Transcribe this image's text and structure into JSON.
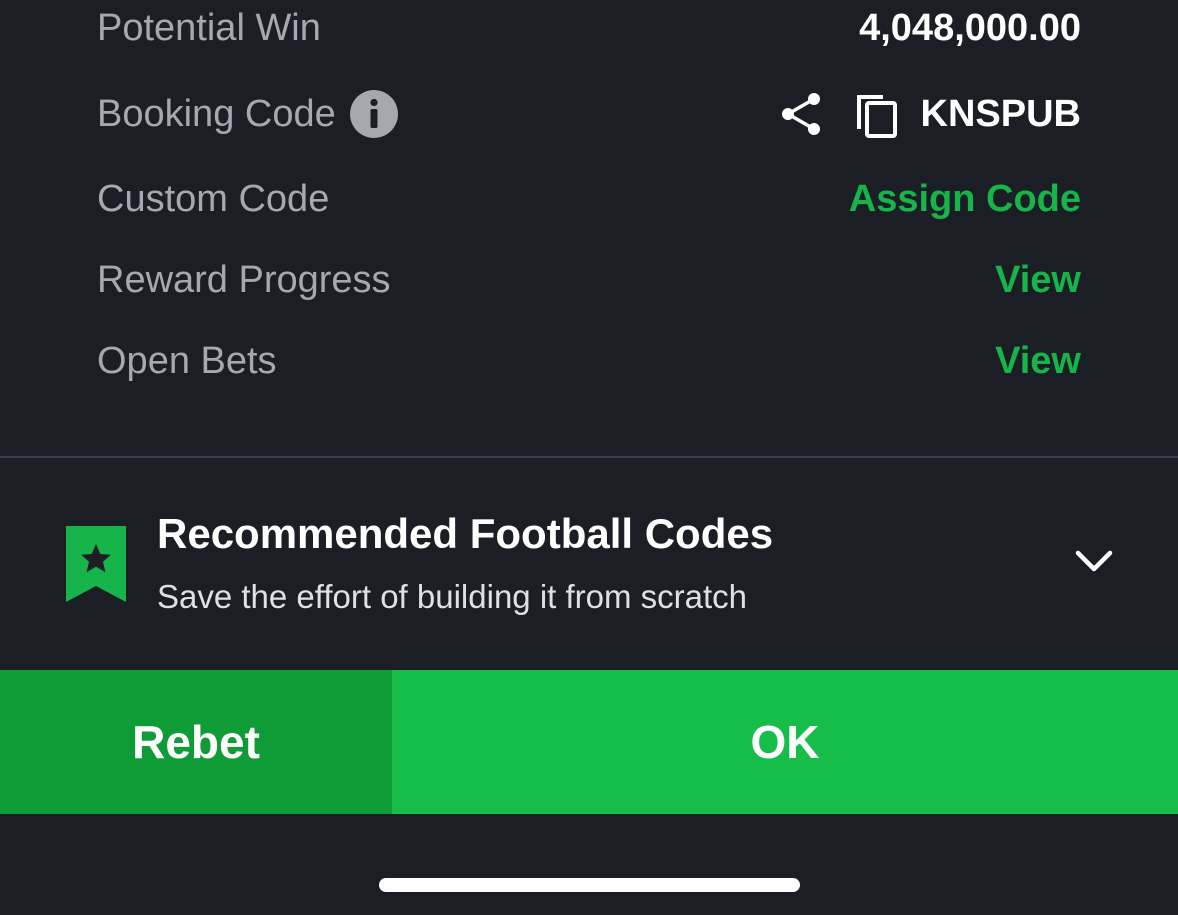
{
  "summary": {
    "potential_win": {
      "label": "Potential Win",
      "value": "4,048,000.00"
    },
    "booking_code": {
      "label": "Booking Code",
      "value": "KNSPUB"
    },
    "custom_code": {
      "label": "Custom Code",
      "action": "Assign Code"
    },
    "reward_progress": {
      "label": "Reward Progress",
      "action": "View"
    },
    "open_bets": {
      "label": "Open Bets",
      "action": "View"
    }
  },
  "recommended": {
    "title": "Recommended Football Codes",
    "subtitle": "Save the effort of building it from scratch"
  },
  "actions": {
    "rebet_label": "Rebet",
    "ok_label": "OK"
  },
  "icons": {
    "info": "info-icon",
    "share": "share-icon",
    "copy": "copy-icon",
    "bookmark": "bookmark-star-icon",
    "chevron": "chevron-down-icon"
  },
  "colors": {
    "background": "#1c1e26",
    "accent_green": "#16b449",
    "ok_button": "#16bd48",
    "rebet_button": "#0f9b35",
    "label_gray": "#a6a8b0"
  }
}
